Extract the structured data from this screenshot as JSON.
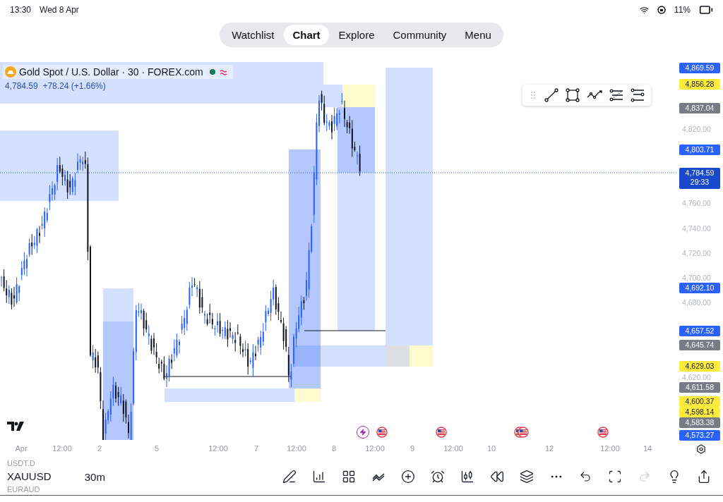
{
  "status_bar": {
    "time": "13:30",
    "date": "Wed 8 Apr",
    "battery": "11%"
  },
  "tabs": [
    {
      "label": "Watchlist",
      "selected": false
    },
    {
      "label": "Chart",
      "selected": true
    },
    {
      "label": "Explore",
      "selected": false
    },
    {
      "label": "Community",
      "selected": false
    },
    {
      "label": "Menu",
      "selected": false
    }
  ],
  "legend": {
    "title": "Gold Spot / U.S. Dollar · 30 · FOREX.com",
    "price": "4,784.59",
    "change": "+78.24 (+1.66%)"
  },
  "price_axis": {
    "ticks": [
      "4,820.00",
      "4,760.00",
      "4,740.00",
      "4,720.00",
      "4,700.00",
      "4,680.00",
      "4,620.00"
    ],
    "tags": [
      {
        "value": "4,869.59",
        "kind": "blue"
      },
      {
        "value": "4,856.28",
        "kind": "yellow"
      },
      {
        "value": "4,837.04",
        "kind": "grey"
      },
      {
        "value": "4,803.71",
        "kind": "blue"
      },
      {
        "value": "4,784.59",
        "kind": "current",
        "countdown": "29:33"
      },
      {
        "value": "4,692.10",
        "kind": "blue"
      },
      {
        "value": "4,657.52",
        "kind": "blue"
      },
      {
        "value": "4,645.74",
        "kind": "grey"
      },
      {
        "value": "4,629.03",
        "kind": "yellow"
      },
      {
        "value": "4,611.58",
        "kind": "grey"
      },
      {
        "value": "4,600.37",
        "kind": "yellow"
      },
      {
        "value": "4,598.14",
        "kind": "yellow"
      },
      {
        "value": "4,583.38",
        "kind": "grey"
      },
      {
        "value": "4,573.27",
        "kind": "blue"
      }
    ]
  },
  "time_axis": {
    "labels": [
      "Apr",
      "12:00",
      "2",
      "5",
      "12:00",
      "7",
      "12:00",
      "8",
      "12:00",
      "9",
      "12:00",
      "10",
      "12",
      "12:00",
      "14"
    ]
  },
  "events": [
    {
      "kind": "flash"
    },
    {
      "kind": "flag"
    },
    {
      "kind": "flag"
    },
    {
      "kind": "flag"
    },
    {
      "kind": "flag"
    },
    {
      "kind": "flag"
    }
  ],
  "bottom_bar": {
    "symbols": [
      {
        "label": "USDT.D",
        "selected": false
      },
      {
        "label": "XAUUSD",
        "selected": true
      },
      {
        "label": "EURAUD",
        "selected": false
      }
    ],
    "interval": "30m",
    "redo_disabled": true
  }
}
